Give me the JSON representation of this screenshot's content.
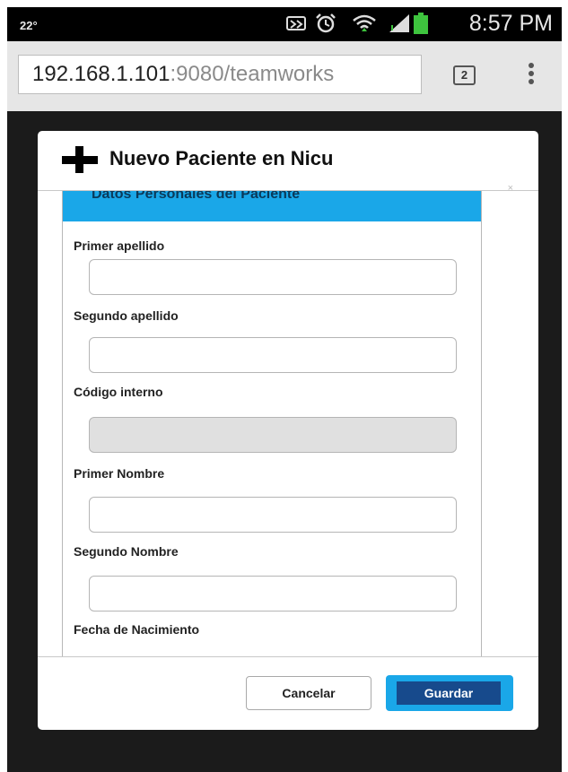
{
  "status_bar": {
    "temperature": "22°",
    "time": "8:57 PM",
    "icons": [
      "nfc-icon",
      "alarm-icon",
      "wifi-icon",
      "signal-icon",
      "battery-icon"
    ]
  },
  "browser": {
    "url_host": "192.168.1.101",
    "url_path": ":9080/teamworks",
    "tab_count": "2",
    "menu_icon": "overflow-menu-icon"
  },
  "modal": {
    "title": "Nuevo Paciente en Nicu",
    "title_icon": "plus-icon",
    "close_icon": "close-icon",
    "section_title": "Datos Personales del Paciente",
    "fields": [
      {
        "label": "Primer apellido",
        "value": "",
        "disabled": false
      },
      {
        "label": "Segundo apellido",
        "value": "",
        "disabled": false
      },
      {
        "label": "Código interno",
        "value": "",
        "disabled": true
      },
      {
        "label": "Primer Nombre",
        "value": "",
        "disabled": false
      },
      {
        "label": "Segundo Nombre",
        "value": "",
        "disabled": false
      },
      {
        "label": "Fecha de Nacimiento"
      }
    ],
    "buttons": {
      "cancel": "Cancelar",
      "save": "Guardar"
    }
  },
  "colors": {
    "accent": "#1aa7e8",
    "primary_button": "#174a8c",
    "backdrop": "#1b1b1b"
  }
}
